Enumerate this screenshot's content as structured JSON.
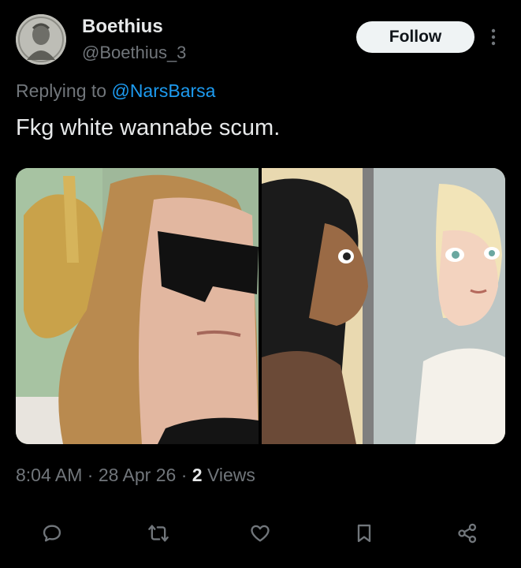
{
  "post": {
    "author_name": "Boethius",
    "author_handle": "@Boethius_3",
    "follow_label": "Follow",
    "replying_prefix": "Replying to ",
    "replying_to": "@NarsBarsa",
    "text": "Fkg white wannabe scum.",
    "time": "8:04 AM",
    "date": "28 Apr 26",
    "views_count": "2",
    "views_label": "Views"
  },
  "colors": {
    "background": "#000000",
    "text_primary": "#e7e9ea",
    "text_secondary": "#71767b",
    "link": "#1d9bf0",
    "follow_bg": "#eff3f4"
  },
  "icons": {
    "more": "more-vertical-icon",
    "reply": "reply-bubble-icon",
    "repost": "repost-arrows-icon",
    "like": "heart-icon",
    "bookmark": "bookmark-icon",
    "share": "share-nodes-icon"
  }
}
